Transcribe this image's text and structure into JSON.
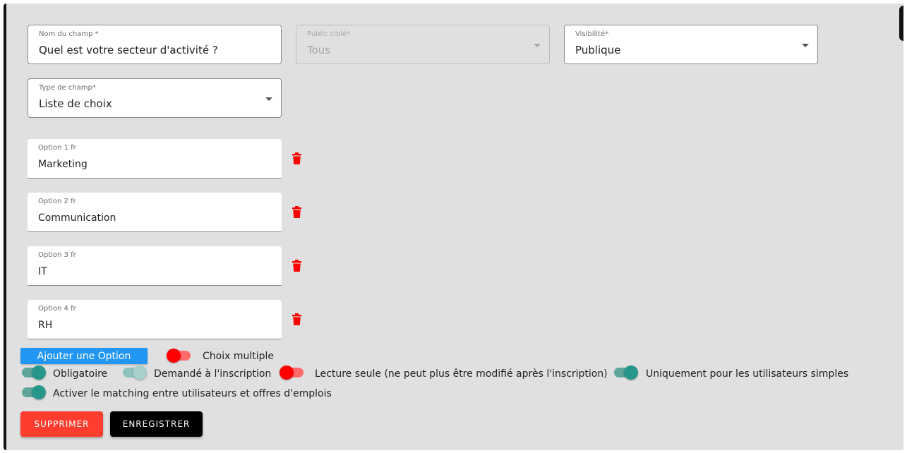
{
  "fields": {
    "name": {
      "label": "Nom du champ *",
      "value": "Quel est votre secteur d'activité ?"
    },
    "audience": {
      "label": "Public ciblé*",
      "value": "Tous"
    },
    "visibility": {
      "label": "Visibilité*",
      "value": "Publique"
    },
    "type": {
      "label": "Type de champ*",
      "value": "Liste de choix"
    }
  },
  "options": [
    {
      "label": "Option 1 fr",
      "value": "Marketing"
    },
    {
      "label": "Option 2 fr",
      "value": "Communication"
    },
    {
      "label": "Option 3 fr",
      "value": "IT"
    },
    {
      "label": "Option 4 fr",
      "value": "RH"
    }
  ],
  "add_option_label": "Ajouter une Option",
  "toggles": {
    "multiple": {
      "label": "Choix multiple",
      "state": "off"
    },
    "required": {
      "label": "Obligatoire",
      "state": "on"
    },
    "signup": {
      "label": "Demandé à l'inscription",
      "state": "on-disabled"
    },
    "readonly": {
      "label": "Lecture seule (ne peut plus être modifié après l'inscription)",
      "state": "off"
    },
    "simple_users": {
      "label": "Uniquement pour les utilisateurs simples",
      "state": "on"
    },
    "matching": {
      "label": "Activer le matching entre utilisateurs et offres d'emplois",
      "state": "on"
    }
  },
  "actions": {
    "delete_label": "SUPPRIMER",
    "save_label": "ENREGISTRER"
  },
  "colors": {
    "primary": "#2196f3",
    "toggle_on": "#26968a",
    "toggle_off": "#ff0000",
    "danger": "#ff3d2e",
    "dark": "#000000"
  },
  "icons": {
    "delete_option": "trash-icon",
    "dropdown": "chevron-down-icon"
  }
}
